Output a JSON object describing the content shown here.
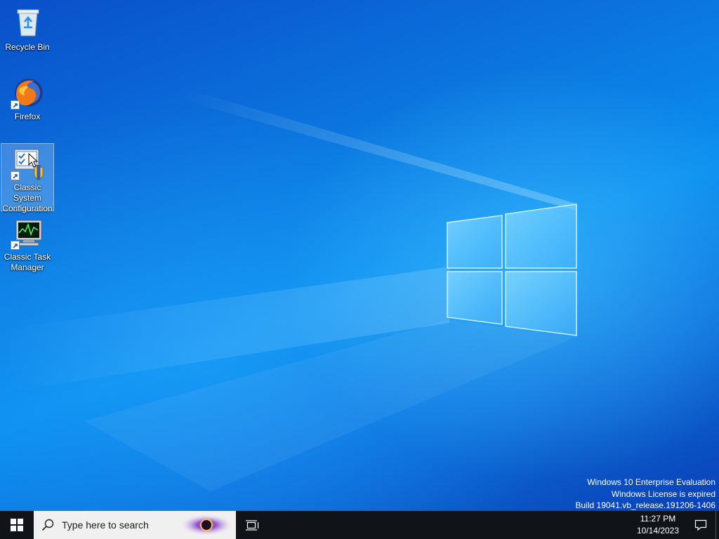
{
  "desktop": {
    "icons": [
      {
        "label": "Recycle Bin"
      },
      {
        "label": "Firefox"
      },
      {
        "label": "Classic System Configuration"
      },
      {
        "label": "Classic Task Manager"
      }
    ]
  },
  "watermark": {
    "line1": "Windows 10 Enterprise Evaluation",
    "line2": "Windows License is expired",
    "line3": "Build 19041.vb_release.191206-1406"
  },
  "taskbar": {
    "search_placeholder": "Type here to search",
    "time": "11:27 PM",
    "date": "10/14/2023"
  },
  "colors": {
    "taskbar": "#101418",
    "search_box": "#f0f0f0",
    "desktop_accent": "#0a78e0"
  }
}
